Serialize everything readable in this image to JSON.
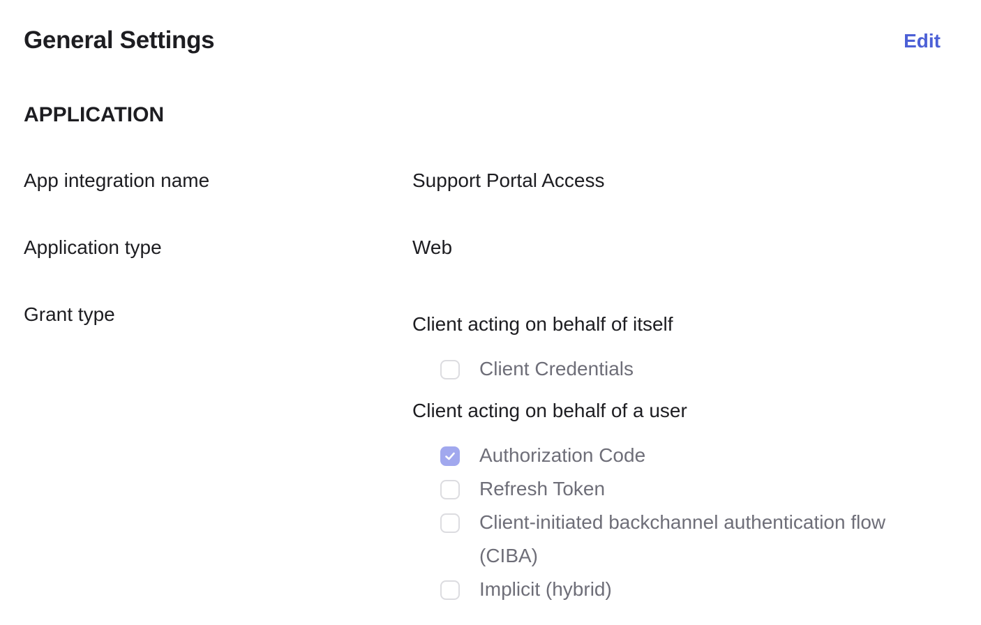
{
  "header": {
    "title": "General Settings",
    "edit_label": "Edit"
  },
  "section": {
    "heading": "APPLICATION"
  },
  "fields": {
    "app_name": {
      "label": "App integration name",
      "value": "Support Portal Access"
    },
    "app_type": {
      "label": "Application type",
      "value": "Web"
    },
    "grant_type": {
      "label": "Grant type"
    }
  },
  "grant_groups": {
    "itself": {
      "title": "Client acting on behalf of itself",
      "options": [
        {
          "label": "Client Credentials",
          "checked": false
        }
      ]
    },
    "user": {
      "title": "Client acting on behalf of a user",
      "options": [
        {
          "label": "Authorization Code",
          "checked": true
        },
        {
          "label": "Refresh Token",
          "checked": false
        },
        {
          "label": "Client-initiated backchannel authentication flow (CIBA)",
          "checked": false
        },
        {
          "label": "Implicit (hybrid)",
          "checked": false
        }
      ]
    }
  },
  "colors": {
    "accent": "#4c60d6",
    "checkbox_checked": "#a1a8ee",
    "checkbox_border": "#dcdce0",
    "text_primary": "#1d1d21",
    "text_muted": "#6e6e78"
  },
  "icons": {
    "checkmark": "check-icon"
  }
}
